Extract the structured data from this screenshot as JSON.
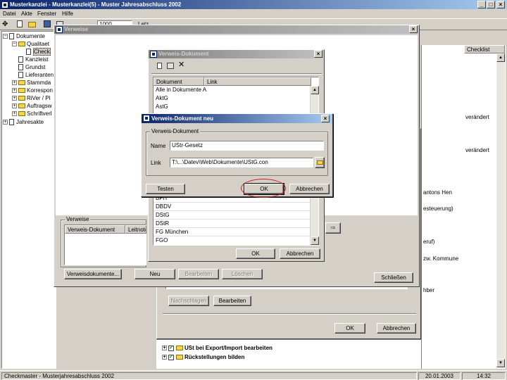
{
  "app": {
    "title": "Musterkanzlei - Musterkanzlei(5) - Muster Jahresabschluss 2002",
    "menu": [
      "Datei",
      "Akte",
      "Fenster",
      "Hilfe"
    ],
    "toolbar_combo_value": "1000",
    "toolbar_partial": "Letz"
  },
  "tree": {
    "root_label": "Dokumente",
    "items": [
      {
        "label": "Qualitaet"
      },
      {
        "label": "Check"
      },
      {
        "label": "Kanzleist"
      },
      {
        "label": "Grundst"
      },
      {
        "label": "Lieferanten"
      },
      {
        "label": "Stammda"
      },
      {
        "label": "Korrespon"
      },
      {
        "label": "RiVer / Pl"
      },
      {
        "label": "Auftragsw"
      },
      {
        "label": "Schriftverl"
      }
    ],
    "last_root": "Jahresakte"
  },
  "right_panel": {
    "column_header": "Checklist",
    "texts": [
      "verändert",
      "verändert",
      "antons Hen",
      "esteuerung)",
      "eruf)",
      "zw. Kommune",
      "hber"
    ]
  },
  "bottom_list": {
    "items": [
      "USt bei Export/Import bearbeiten",
      "Rückstellungen bilden"
    ]
  },
  "back_dialog": {
    "nachschlagen_label": "Nachschlagen",
    "bearbeiten_label": "Bearbeiten",
    "ok_label": "OK",
    "abbrechen_label": "Abbrechen"
  },
  "verweise_window": {
    "title": "Verweise",
    "group_title": "Verweise",
    "col_document": "Verweis-Dokument",
    "col_edit": "Leitnote",
    "btn_verweisdokumente": "Verweisdokumente...",
    "btn_neu": "Neu",
    "btn_bearbeiten": "Bearbeiten",
    "btn_loeschen": "Löschen",
    "btn_schliessen": "Schließen"
  },
  "doc_window": {
    "title": "Verweis-Dokument",
    "col_dokument": "Dokument",
    "col_link": "Link",
    "top_items": [
      "Alle in Dokumente A",
      "AktG",
      "AstG"
    ],
    "bottom_items": [
      "BFH",
      "DBDV",
      "DStG",
      "DStR",
      "FG München",
      "FGO"
    ],
    "ok_label": "OK",
    "abbrechen_label": "Abbrechen"
  },
  "new_dialog": {
    "title": "Verweis-Dokument neu",
    "group_title": "Verweis-Dokument",
    "name_label": "Name",
    "name_value": "UStr-Gesetz",
    "link_label": "Link",
    "link_value": "T:\\...\\Datev\\Web\\Dokumente\\UStG.con",
    "testen_label": "Testen",
    "ok_label": "OK",
    "abbrechen_label": "Abbrechen"
  },
  "status": {
    "left": "Checkmaster - Musterjahresabschluss 2002",
    "date": "20.01.2003",
    "time": "14:32"
  },
  "colors": {
    "title_active": "#0a246a",
    "highlight_circle": "#cc2222"
  }
}
